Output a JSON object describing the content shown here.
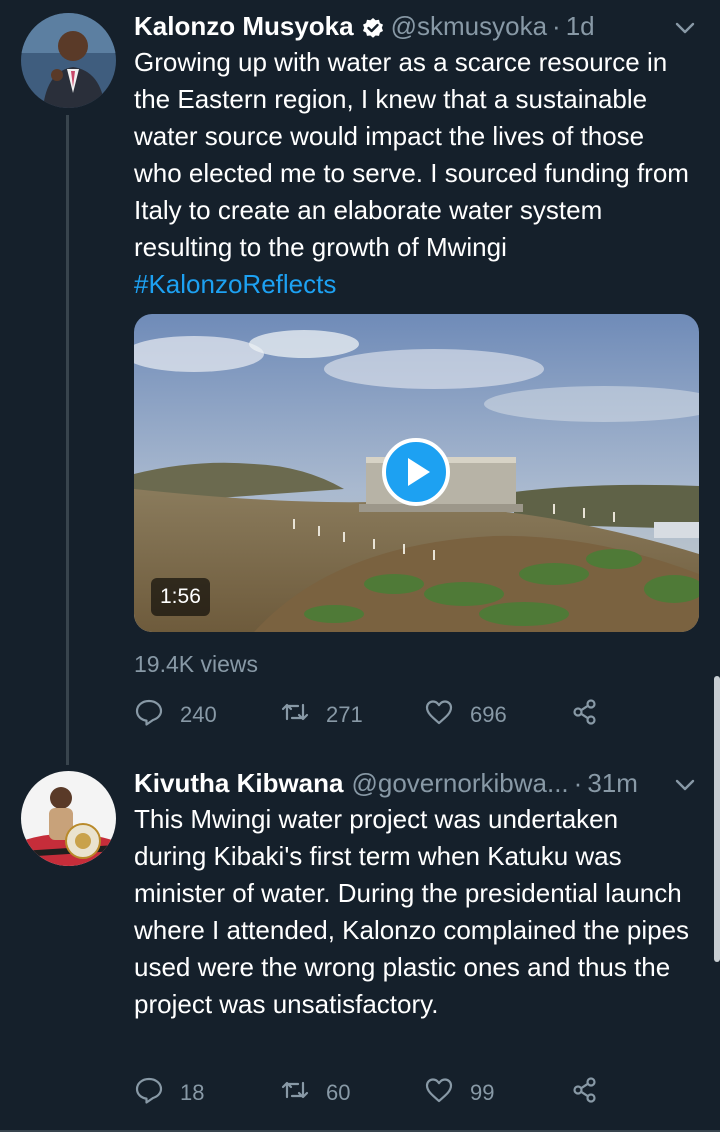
{
  "tweets": [
    {
      "author_name": "Kalonzo Musyoka",
      "handle": "@skmusyoka",
      "separator": "·",
      "time": "1d",
      "verified": true,
      "text_main": "Growing up with water as a scarce resource in the Eastern region, I knew that a sustainable water source would impact the lives of those who elected me to serve. I sourced funding from Italy to create an elaborate water system resulting to the growth of Mwingi ",
      "hashtag": "#KalonzoReflects",
      "video_duration": "1:56",
      "views": "19.4K views",
      "replies": "240",
      "retweets": "271",
      "likes": "696",
      "avatar_icon": "person-avatar",
      "caret_icon": "chevron-down-icon"
    },
    {
      "author_name": "Kivutha Kibwana",
      "handle": "@governorkibwa...",
      "separator": "·",
      "time": "31m",
      "text_main": "This Mwingi water project was undertaken during Kibaki's first term when Katuku was minister of water. During the presidential launch  where I attended, Kalonzo complained the pipes used were the wrong plastic ones and thus the project was unsatisfactory.",
      "replies": "18",
      "retweets": "60",
      "likes": "99",
      "avatar_icon": "person-avatar",
      "caret_icon": "chevron-down-icon"
    }
  ],
  "colors": {
    "background": "#15202b",
    "accent": "#1da1f2",
    "muted": "#8899a6",
    "divider": "#38444d"
  }
}
